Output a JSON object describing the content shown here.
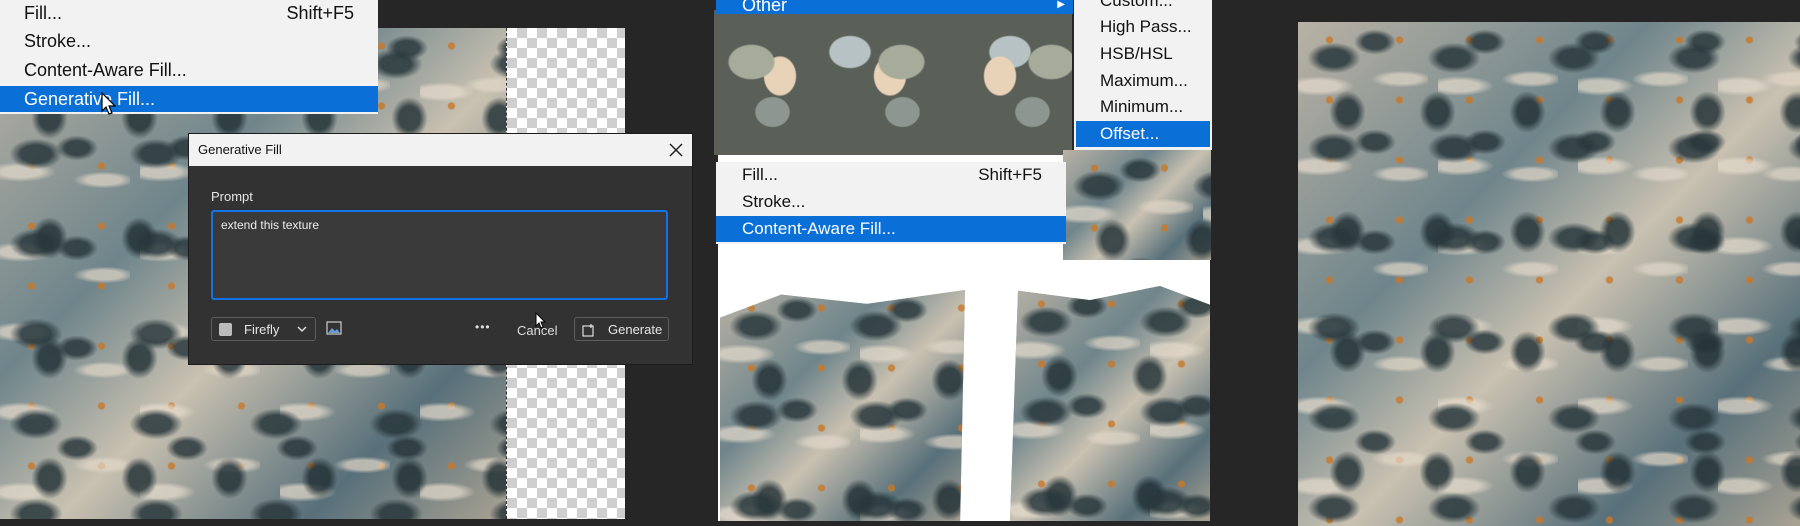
{
  "left_panel": {
    "edit_menu": {
      "items": [
        {
          "label": "Fill...",
          "shortcut": "Shift+F5"
        },
        {
          "label": "Stroke...",
          "shortcut": ""
        },
        {
          "label": "Content-Aware Fill...",
          "shortcut": ""
        },
        {
          "label": "Generative Fill...",
          "shortcut": "",
          "selected": true
        }
      ]
    },
    "dialog": {
      "title": "Generative Fill",
      "prompt_label": "Prompt",
      "prompt_value": "extend this texture",
      "model_label": "Firefly",
      "more_label": "•••",
      "cancel_label": "Cancel",
      "generate_label": "Generate"
    }
  },
  "middle_panel": {
    "filter_menu": {
      "other_label": "Other",
      "submenu_items": [
        {
          "label": "Custom..."
        },
        {
          "label": "High Pass..."
        },
        {
          "label": "HSB/HSL"
        },
        {
          "label": "Maximum..."
        },
        {
          "label": "Minimum..."
        },
        {
          "label": "Offset...",
          "selected": true
        }
      ]
    },
    "edit_menu": {
      "items": [
        {
          "label": "Fill...",
          "shortcut": "Shift+F5"
        },
        {
          "label": "Stroke...",
          "shortcut": ""
        },
        {
          "label": "Content-Aware Fill...",
          "shortcut": "",
          "selected": true
        }
      ]
    }
  },
  "colors": {
    "selection": "#0a6fd6",
    "menu_bg": "#f2f2f2",
    "dialog_bg": "#323232",
    "app_bg": "#262626"
  }
}
